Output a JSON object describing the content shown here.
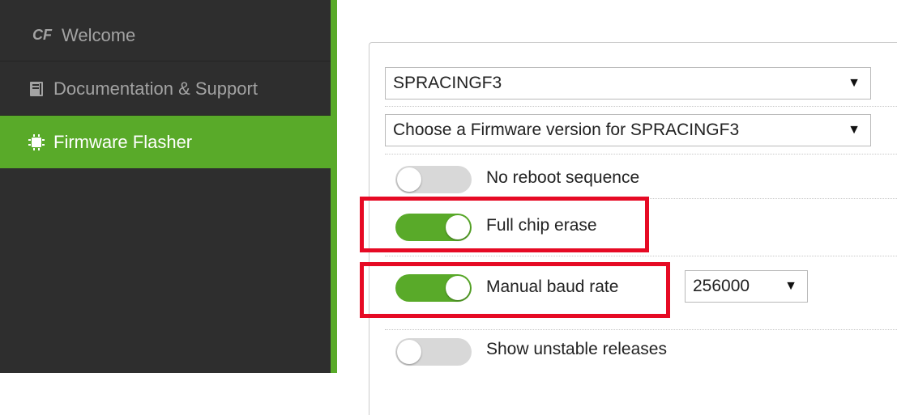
{
  "sidebar": {
    "items": [
      {
        "icon": "cf-logo-icon",
        "icon_text": "CF",
        "label": "Welcome",
        "active": false
      },
      {
        "icon": "book-icon",
        "label": "Documentation & Support",
        "active": false
      },
      {
        "icon": "chip-icon",
        "label": "Firmware Flasher",
        "active": true
      }
    ]
  },
  "flasher": {
    "board_select": {
      "value": "SPRACINGF3"
    },
    "firmware_select": {
      "value": "Choose a Firmware version for SPRACINGF3"
    },
    "options": [
      {
        "label": "No reboot sequence",
        "enabled": false
      },
      {
        "label": "Full chip erase",
        "enabled": true
      },
      {
        "label": "Manual baud rate",
        "enabled": true
      },
      {
        "label": "Show unstable releases",
        "enabled": false
      }
    ],
    "baud_select": {
      "value": "256000"
    }
  },
  "colors": {
    "accent_green": "#59aa29",
    "sidebar_bg": "#2e2e2e",
    "highlight_red": "#e60a24"
  }
}
